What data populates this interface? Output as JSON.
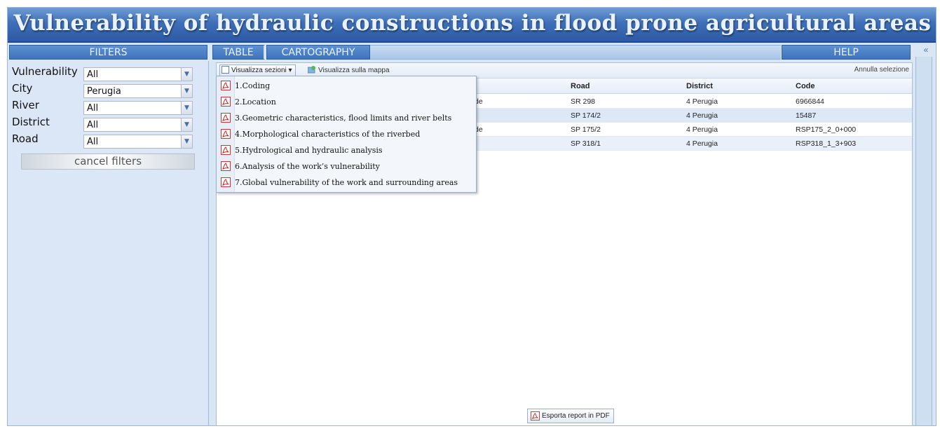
{
  "header": {
    "title": "Vulnerability of hydraulic constructions in flood prone agricultural areas"
  },
  "tabs": {
    "filters": "FILTERS",
    "table": "TABLE",
    "cartography": "CARTOGRAPHY",
    "help": "HELP",
    "collapse": "«"
  },
  "filters": [
    {
      "label": "Vulnerability",
      "value": "All"
    },
    {
      "label": "City",
      "value": "Perugia"
    },
    {
      "label": "River",
      "value": "All"
    },
    {
      "label": "District",
      "value": "All"
    },
    {
      "label": "Road",
      "value": "All"
    }
  ],
  "cancel_filters": "cancel filters",
  "toolbar": {
    "sections": "Visualizza sezioni",
    "show_map": "Visualizza sulla mappa",
    "clear_selection": "Annulla selezione"
  },
  "grid": {
    "columns": {
      "road": "Road",
      "district": "District",
      "code": "Code"
    },
    "rows": [
      {
        "partial": "de",
        "road": "SR 298",
        "district": "4 Perugia",
        "code": "6966844"
      },
      {
        "partial": "",
        "road": "SP 174/2",
        "district": "4 Perugia",
        "code": "15487"
      },
      {
        "partial": "de",
        "road": "SP 175/2",
        "district": "4 Perugia",
        "code": "RSP175_2_0+000"
      },
      {
        "partial": "",
        "road": "SP 318/1",
        "district": "4 Perugia",
        "code": "RSP318_1_3+903"
      }
    ]
  },
  "sections_menu": [
    "1.Coding",
    "2.Location",
    "3.Geometric characteristics, flood limits and river belts",
    "4.Morphological characteristics of the riverbed",
    "5.Hydrological and hydraulic analysis",
    "6.Analysis of the work’s vulnerability",
    "7.Global vulnerability of the work and surrounding areas"
  ],
  "export_button": "Esporta report in PDF"
}
